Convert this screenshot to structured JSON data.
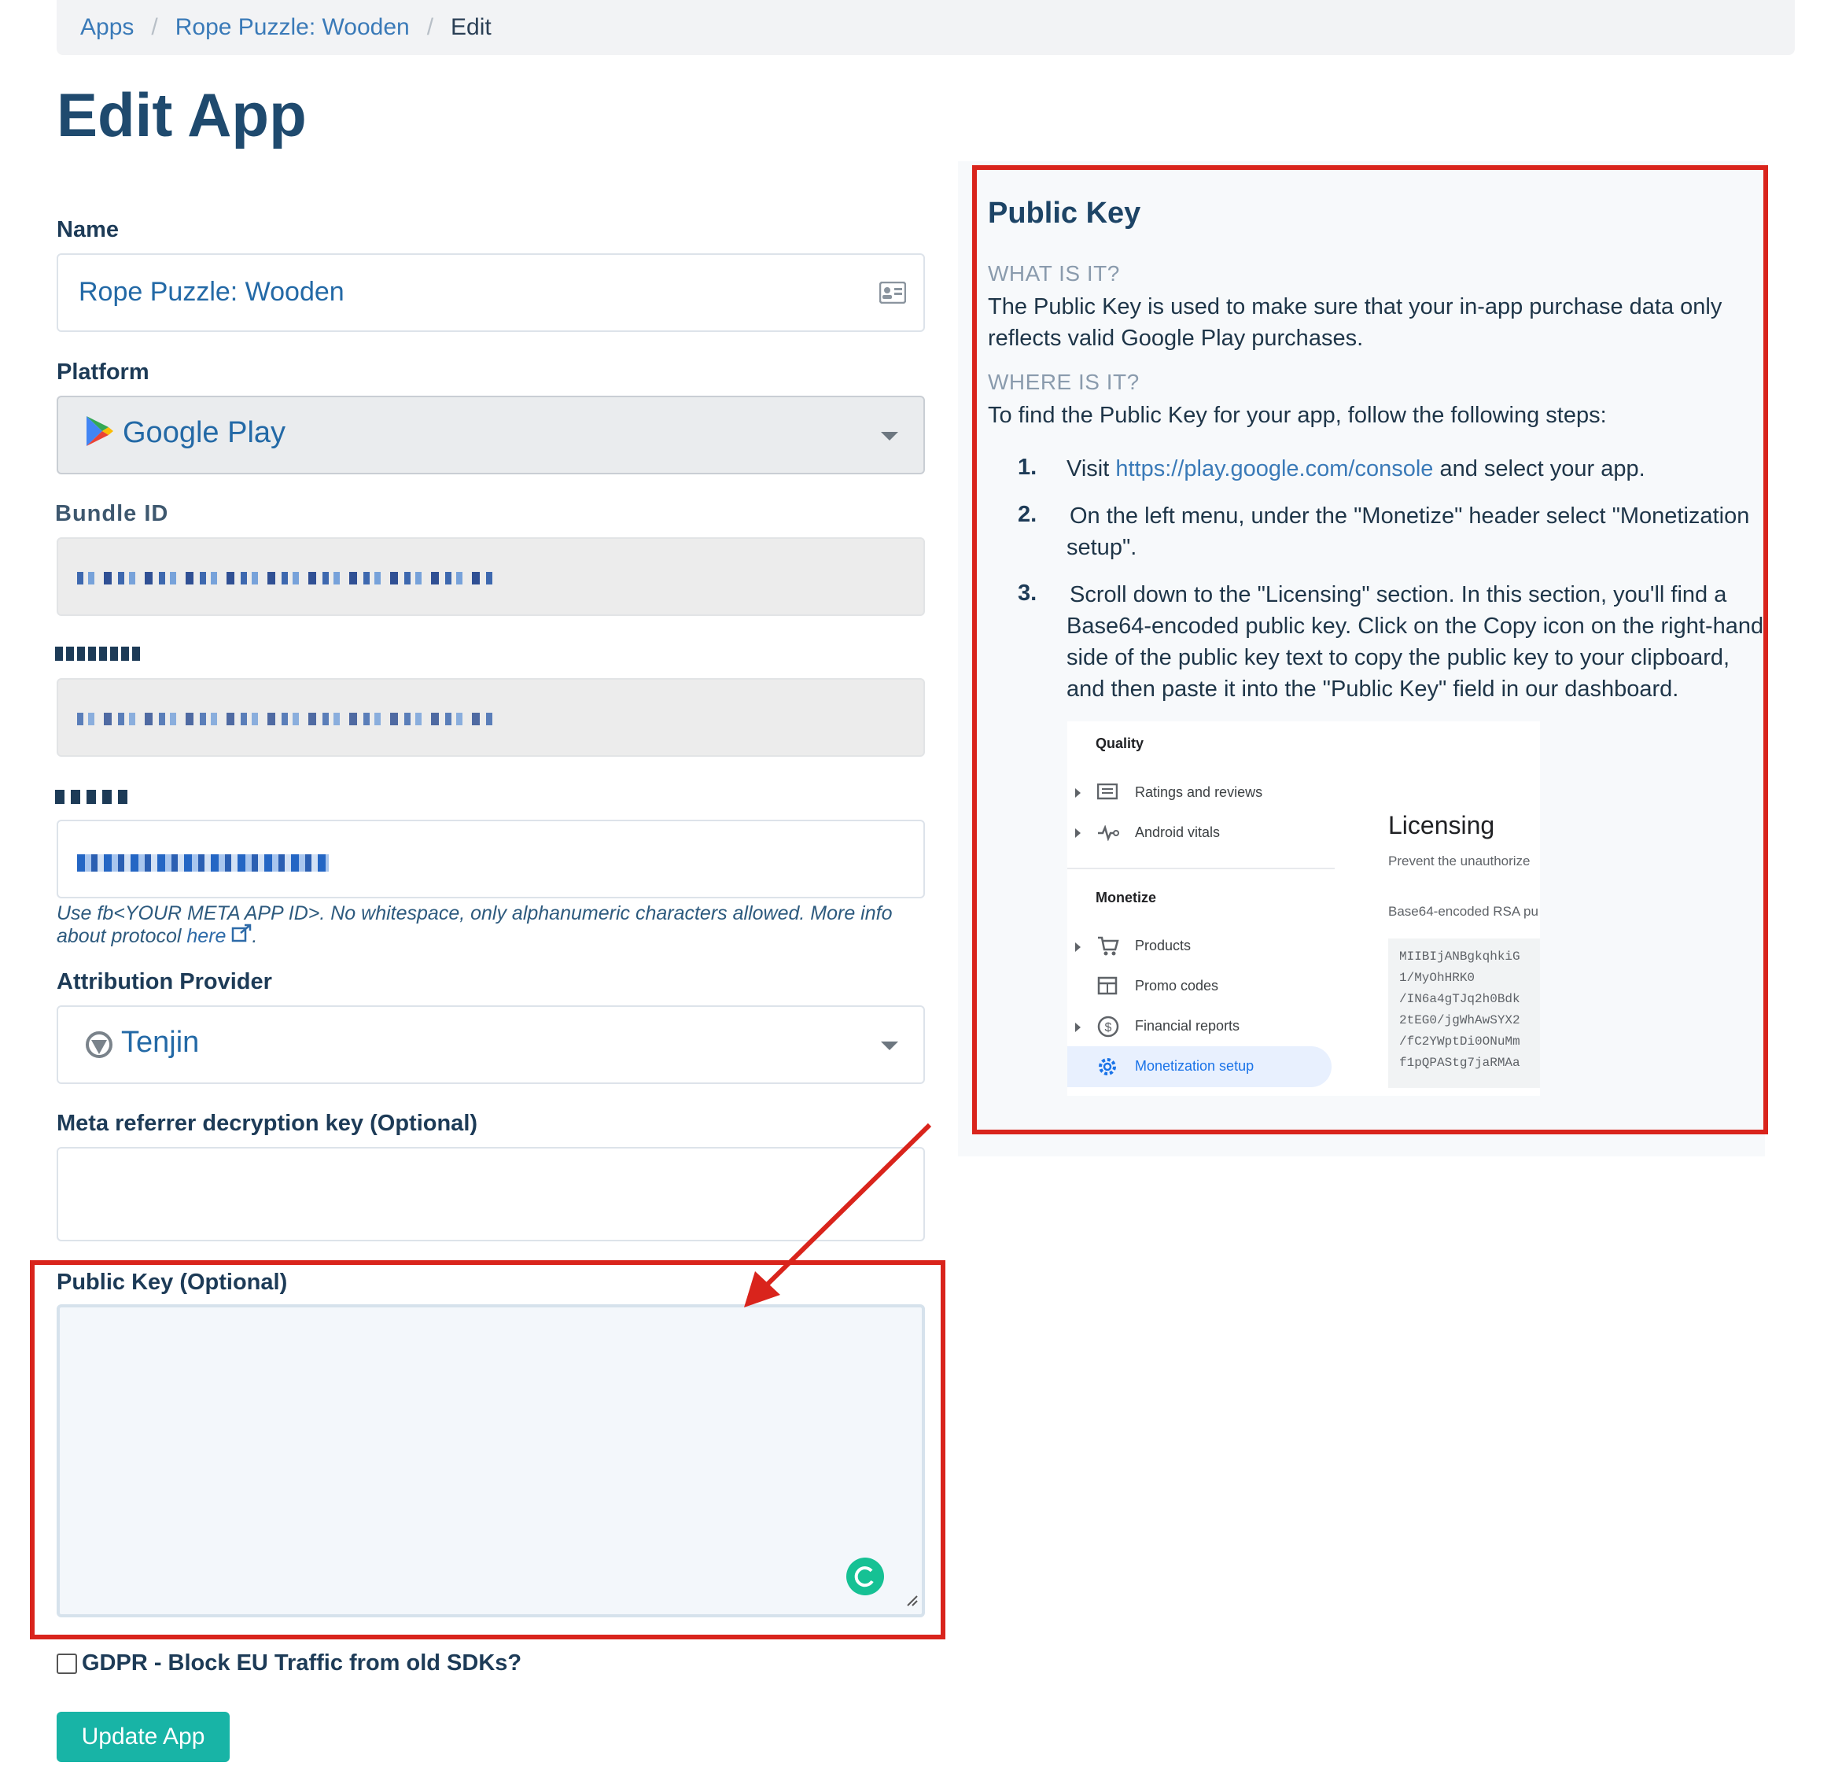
{
  "breadcrumb": {
    "items": [
      "Apps",
      "Rope Puzzle: Wooden"
    ],
    "current": "Edit",
    "separator": "/"
  },
  "page_title": "Edit App",
  "form": {
    "name_label": "Name",
    "name_value": "Rope Puzzle: Wooden",
    "platform_label": "Platform",
    "platform_value": "Google Play",
    "bundle_label": "Bundle ID",
    "fb_help": "Use fb<YOUR META APP ID>. No whitespace, only alphanumeric characters allowed. More info about protocol",
    "fb_help_link": "here",
    "attribution_label": "Attribution Provider",
    "attribution_value": "Tenjin",
    "meta_label": "Meta referrer decryption key (Optional)",
    "meta_value": "",
    "public_key_label": "Public Key (Optional)",
    "public_key_value": "",
    "gdpr_label": "GDPR - Block EU Traffic from old SDKs?",
    "gdpr_checked": false,
    "submit_label": "Update App"
  },
  "panel": {
    "title": "Public Key",
    "what_heading": "WHAT IS IT?",
    "what_line1": "The Public Key is used to make sure that your in-app purchase data only",
    "what_line2": "reflects valid Google Play purchases.",
    "where_heading": "WHERE IS IT?",
    "where_text": "To find the Public Key for your app, follow the following steps:",
    "steps": [
      {
        "num": "1.",
        "pre": "Visit",
        "link": "https://play.google.com/console",
        "post": "and select your app."
      },
      {
        "num": "2.",
        "line1": "On the left menu, under the \"Monetize\" header select \"Monetization",
        "line2": "setup\"."
      },
      {
        "num": "3.",
        "line1": "Scroll down to the \"Licensing\" section. In this section, you'll find a",
        "line2": "Base64-encoded public key. Click on the Copy icon on the right-hand",
        "line3": "side of the public key text to copy the public key to your clipboard,",
        "line4": "and then paste it into the \"Public Key\" field in our dashboard."
      }
    ],
    "screenshot": {
      "quality_header": "Quality",
      "ratings": "Ratings and reviews",
      "vitals": "Android vitals",
      "monetize_header": "Monetize",
      "products": "Products",
      "promo": "Promo codes",
      "financial": "Financial reports",
      "monetization_setup": "Monetization setup",
      "licensing_title": "Licensing",
      "licensing_desc": "Prevent the unauthorize",
      "rsa_label": "Base64-encoded RSA pu",
      "key_lines": [
        "MIIBIjANBgkqhkiG",
        "1/MyOhHRK0",
        "/IN6a4gTJq2h0Bdk",
        "2tEG0/jgWhAwSYX2",
        "/fC2YWptDi0ONuMm",
        "f1pQPAStg7jaRMAa"
      ]
    },
    "colors": {
      "highlight_red": "#d9241c",
      "accent_teal": "#18b4a6",
      "link_blue": "#3a7ab8"
    }
  }
}
